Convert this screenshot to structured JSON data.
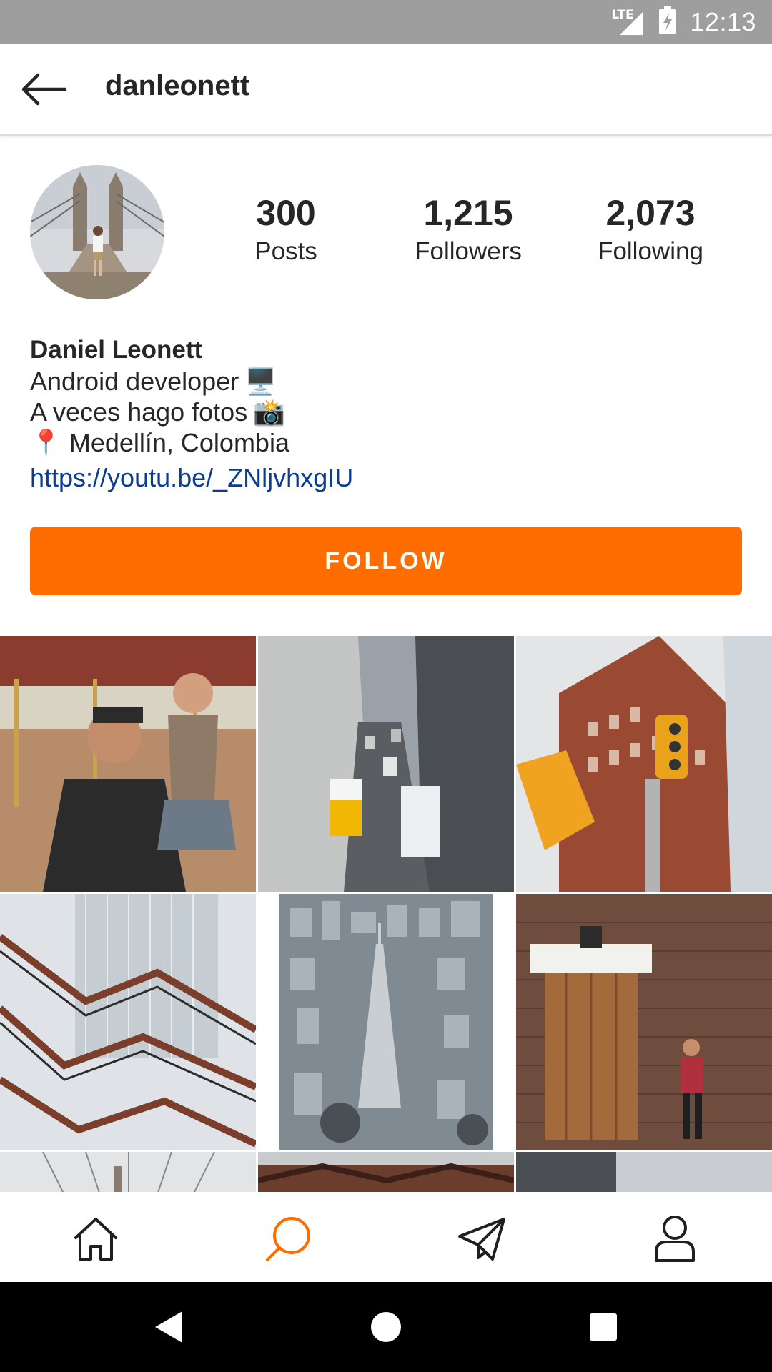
{
  "status_bar": {
    "time": "12:13",
    "network": "LTE",
    "icons": [
      "lte-signal-icon",
      "battery-charging-icon"
    ]
  },
  "app_bar": {
    "title": "danleonett",
    "back_icon": "arrow-back-icon"
  },
  "profile": {
    "stats": [
      {
        "value": "300",
        "label": "Posts"
      },
      {
        "value": "1,215",
        "label": "Followers"
      },
      {
        "value": "2,073",
        "label": "Following"
      }
    ],
    "name": "Daniel Leonett",
    "bio_lines": [
      {
        "text": "Android developer",
        "emoji": "🖥️"
      },
      {
        "text": "A veces hago fotos",
        "emoji": "📸"
      },
      {
        "emoji": "📍",
        "text": "Medellín, Colombia"
      }
    ],
    "link": "https://youtu.be/_ZNljvhxgIU"
  },
  "follow_button": {
    "label": "FOLLOW",
    "color": "#ff6d00"
  },
  "grid": {
    "tiles": [
      "carousel-selfie-photo",
      "street-traffic-photo",
      "traffic-light-building-photo",
      "vessel-staircase-photo",
      "empire-state-aerial-photo",
      "wooden-door-brick-wall-photo",
      "bridge-photo",
      "vessel-interior-photo",
      "storefront-photo"
    ]
  },
  "bottom_nav": {
    "items": [
      "home-icon",
      "search-icon",
      "direct-message-icon",
      "profile-icon"
    ],
    "active": "search-icon",
    "active_color": "#ff6d00"
  },
  "system_nav": {
    "items": [
      "back-triangle-icon",
      "home-circle-icon",
      "recents-square-icon"
    ]
  }
}
